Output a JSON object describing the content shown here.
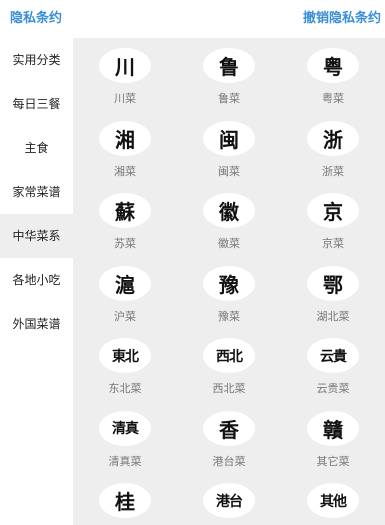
{
  "header": {
    "privacy_policy": "隐私条约",
    "revoke_privacy": "撤销隐私条约"
  },
  "sidebar": {
    "selected_index": 4,
    "items": [
      {
        "label": "实用分类"
      },
      {
        "label": "每日三餐"
      },
      {
        "label": "主食"
      },
      {
        "label": "家常菜谱"
      },
      {
        "label": "中华菜系"
      },
      {
        "label": "各地小吃"
      },
      {
        "label": "外国菜谱"
      }
    ]
  },
  "cuisines": [
    {
      "glyph": "川",
      "label": "川菜"
    },
    {
      "glyph": "鲁",
      "label": "鲁菜"
    },
    {
      "glyph": "粤",
      "label": "粤菜"
    },
    {
      "glyph": "湘",
      "label": "湘菜"
    },
    {
      "glyph": "闽",
      "label": "闽菜"
    },
    {
      "glyph": "浙",
      "label": "浙菜"
    },
    {
      "glyph": "蘇",
      "label": "苏菜"
    },
    {
      "glyph": "徽",
      "label": "徽菜"
    },
    {
      "glyph": "京",
      "label": "京菜"
    },
    {
      "glyph": "滬",
      "label": "沪菜"
    },
    {
      "glyph": "豫",
      "label": "豫菜"
    },
    {
      "glyph": "鄂",
      "label": "湖北菜"
    },
    {
      "glyph": "東北",
      "label": "东北菜"
    },
    {
      "glyph": "西北",
      "label": "西北菜"
    },
    {
      "glyph": "云貴",
      "label": "云贵菜"
    },
    {
      "glyph": "清真",
      "label": "清真菜"
    },
    {
      "glyph": "香",
      "label": "港台菜"
    },
    {
      "glyph": "贛",
      "label": "其它菜"
    },
    {
      "glyph": "桂",
      "label": ""
    },
    {
      "glyph": "港台",
      "label": ""
    },
    {
      "glyph": "其他",
      "label": ""
    }
  ]
}
